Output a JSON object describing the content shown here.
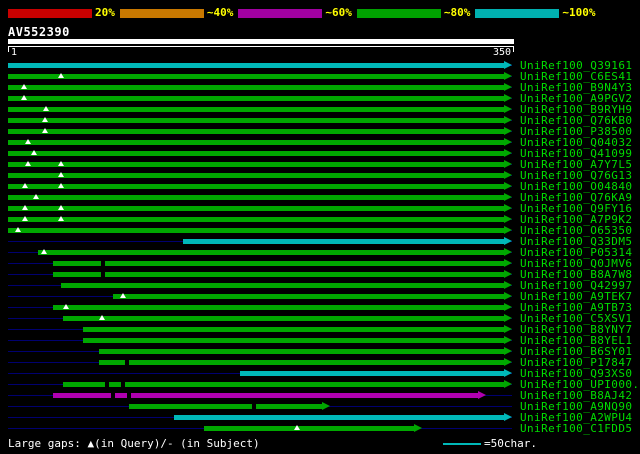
{
  "page": {
    "background": "#000000"
  },
  "key": {
    "label_color": "#ffff00",
    "items": [
      {
        "label": "20%",
        "color": "#c80000"
      },
      {
        "label": "~40%",
        "color": "#c87800"
      },
      {
        "label": "~60%",
        "color": "#a000a0"
      },
      {
        "label": "~80%",
        "color": "#00a000"
      },
      {
        "label": "~100%",
        "color": "#00b0b0"
      }
    ]
  },
  "query": {
    "name": "AV552390",
    "scale_start": "1",
    "scale_end": "350"
  },
  "footer": {
    "gaps_note": "Large gaps: ▲(in Query)/- (in Subject)",
    "scalebar_label": "=50char."
  },
  "chart_data": {
    "type": "alignment-overview",
    "title": "AV552390 similarity search graphical overview",
    "x_range": [
      1,
      350
    ],
    "query_name": "AV552390",
    "palette": {
      "green": "#00a800",
      "cyan": "#00b8b8",
      "magenta": "#b000b0"
    },
    "label_color": "#00dd00",
    "rows": [
      {
        "label": "UniRef100_Q39161",
        "color": "cyan",
        "start": 1,
        "end": 350,
        "gaps_query": [],
        "gaps_subject": []
      },
      {
        "label": "UniRef100_C6ES41",
        "color": "green",
        "start": 1,
        "end": 350,
        "gaps_query": [
          38
        ],
        "gaps_subject": []
      },
      {
        "label": "UniRef100_B9N4Y3",
        "color": "green",
        "start": 1,
        "end": 350,
        "gaps_query": [
          12
        ],
        "gaps_subject": []
      },
      {
        "label": "UniRef100_A9PGV2",
        "color": "green",
        "start": 1,
        "end": 350,
        "gaps_query": [
          12
        ],
        "gaps_subject": []
      },
      {
        "label": "UniRef100_B9RYH9",
        "color": "green",
        "start": 1,
        "end": 350,
        "gaps_query": [
          28
        ],
        "gaps_subject": []
      },
      {
        "label": "UniRef100_Q76KB0",
        "color": "green",
        "start": 1,
        "end": 350,
        "gaps_query": [
          27
        ],
        "gaps_subject": []
      },
      {
        "label": "UniRef100_P38500",
        "color": "green",
        "start": 1,
        "end": 350,
        "gaps_query": [
          27
        ],
        "gaps_subject": []
      },
      {
        "label": "UniRef100_Q04032",
        "color": "green",
        "start": 1,
        "end": 350,
        "gaps_query": [
          15
        ],
        "gaps_subject": []
      },
      {
        "label": "UniRef100_Q41099",
        "color": "green",
        "start": 1,
        "end": 350,
        "gaps_query": [
          19
        ],
        "gaps_subject": []
      },
      {
        "label": "UniRef100_A7Y7L5",
        "color": "green",
        "start": 1,
        "end": 350,
        "gaps_query": [
          15,
          38
        ],
        "gaps_subject": []
      },
      {
        "label": "UniRef100_Q76G13",
        "color": "green",
        "start": 1,
        "end": 350,
        "gaps_query": [
          38
        ],
        "gaps_subject": []
      },
      {
        "label": "UniRef100_O04840",
        "color": "green",
        "start": 1,
        "end": 350,
        "gaps_query": [
          13,
          38
        ],
        "gaps_subject": []
      },
      {
        "label": "UniRef100_Q76KA9",
        "color": "green",
        "start": 1,
        "end": 350,
        "gaps_query": [
          21
        ],
        "gaps_subject": []
      },
      {
        "label": "UniRef100_Q9FY16",
        "color": "green",
        "start": 1,
        "end": 350,
        "gaps_query": [
          13,
          38
        ],
        "gaps_subject": []
      },
      {
        "label": "UniRef100_A7P9K2",
        "color": "green",
        "start": 1,
        "end": 350,
        "gaps_query": [
          13,
          38
        ],
        "gaps_subject": []
      },
      {
        "label": "UniRef100_O65350",
        "color": "green",
        "start": 1,
        "end": 350,
        "gaps_query": [
          8
        ],
        "gaps_subject": []
      },
      {
        "label": "UniRef100_Q33DM5",
        "color": "cyan",
        "start": 124,
        "end": 350,
        "gaps_query": [],
        "gaps_subject": []
      },
      {
        "label": "UniRef100_P05314",
        "color": "green",
        "start": 22,
        "end": 350,
        "gaps_query": [
          26
        ],
        "gaps_subject": []
      },
      {
        "label": "UniRef100_Q0JMV6",
        "color": "green",
        "start": 33,
        "end": 350,
        "gaps_query": [],
        "gaps_subject": [
          68
        ]
      },
      {
        "label": "UniRef100_B8A7W8",
        "color": "green",
        "start": 33,
        "end": 350,
        "gaps_query": [],
        "gaps_subject": [
          68
        ]
      },
      {
        "label": "UniRef100_Q42997",
        "color": "green",
        "start": 38,
        "end": 350,
        "gaps_query": [],
        "gaps_subject": []
      },
      {
        "label": "UniRef100_A9TEK7",
        "color": "green",
        "start": 75,
        "end": 350,
        "gaps_query": [
          82
        ],
        "gaps_subject": []
      },
      {
        "label": "UniRef100_A9TB73",
        "color": "green",
        "start": 33,
        "end": 350,
        "gaps_query": [
          42
        ],
        "gaps_subject": []
      },
      {
        "label": "UniRef100_C5XSV1",
        "color": "green",
        "start": 40,
        "end": 350,
        "gaps_query": [
          67
        ],
        "gaps_subject": []
      },
      {
        "label": "UniRef100_B8YNY7",
        "color": "green",
        "start": 54,
        "end": 350,
        "gaps_query": [],
        "gaps_subject": []
      },
      {
        "label": "UniRef100_B8YEL1",
        "color": "green",
        "start": 54,
        "end": 350,
        "gaps_query": [],
        "gaps_subject": []
      },
      {
        "label": "UniRef100_B6SY01",
        "color": "green",
        "start": 65,
        "end": 350,
        "gaps_query": [],
        "gaps_subject": []
      },
      {
        "label": "UniRef100_P17847",
        "color": "green",
        "start": 65,
        "end": 350,
        "gaps_query": [],
        "gaps_subject": [
          85
        ]
      },
      {
        "label": "UniRef100_Q93XS0",
        "color": "cyan",
        "start": 164,
        "end": 350,
        "gaps_query": [],
        "gaps_subject": []
      },
      {
        "label": "UniRef100_UPI000.",
        "color": "green",
        "start": 40,
        "end": 350,
        "gaps_query": [],
        "gaps_subject": [
          71,
          82
        ]
      },
      {
        "label": "UniRef100_B8AJ42",
        "color": "magenta",
        "start": 33,
        "end": 332,
        "gaps_query": [],
        "gaps_subject": [
          75,
          86
        ]
      },
      {
        "label": "UniRef100_A9NQ90",
        "color": "green",
        "start": 86,
        "end": 222,
        "gaps_query": [],
        "gaps_subject": [
          174
        ]
      },
      {
        "label": "UniRef100_A2WPU4",
        "color": "cyan",
        "start": 118,
        "end": 350,
        "gaps_query": [],
        "gaps_subject": []
      },
      {
        "label": "UniRef100_C1FDD5",
        "color": "green",
        "start": 139,
        "end": 287,
        "gaps_query": [
          204
        ],
        "gaps_subject": []
      }
    ]
  }
}
